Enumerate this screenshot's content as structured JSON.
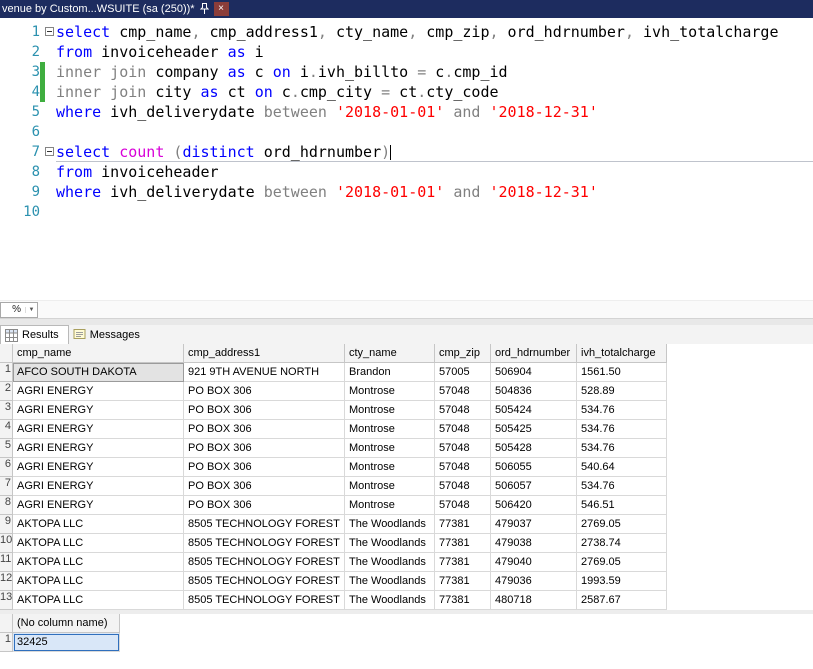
{
  "window": {
    "tab_title": "venue by Custom...WSUITE (sa (250))*",
    "close_glyph": "×"
  },
  "colors": {
    "keyword": "#0000ff",
    "operator": "#808080",
    "string": "#ff0000",
    "function": "#d800d8",
    "line_number": "#2b91af",
    "change_tracking": "#3fae3f",
    "tab_bar_background": "#1d2c5f",
    "selection_border": "#2f6fbd"
  },
  "editor": {
    "zoom_label": "%",
    "lines": [
      {
        "n": 1,
        "fold": true,
        "tokens": [
          {
            "t": "select",
            "c": "kw"
          },
          {
            "t": " cmp_name",
            "c": "pl"
          },
          {
            "t": ",",
            "c": "op"
          },
          {
            "t": " cmp_address1",
            "c": "pl"
          },
          {
            "t": ",",
            "c": "op"
          },
          {
            "t": " cty_name",
            "c": "pl"
          },
          {
            "t": ",",
            "c": "op"
          },
          {
            "t": " cmp_zip",
            "c": "pl"
          },
          {
            "t": ",",
            "c": "op"
          },
          {
            "t": " ord_hdrnumber",
            "c": "pl"
          },
          {
            "t": ",",
            "c": "op"
          },
          {
            "t": " ivh_totalcharge",
            "c": "pl"
          }
        ]
      },
      {
        "n": 2,
        "tokens": [
          {
            "t": "from",
            "c": "kw"
          },
          {
            "t": " invoiceheader ",
            "c": "pl"
          },
          {
            "t": "as",
            "c": "kw"
          },
          {
            "t": " i",
            "c": "pl"
          }
        ]
      },
      {
        "n": 3,
        "changed": true,
        "tokens": [
          {
            "t": "inner join",
            "c": "op"
          },
          {
            "t": " company ",
            "c": "pl"
          },
          {
            "t": "as",
            "c": "kw"
          },
          {
            "t": " c ",
            "c": "pl"
          },
          {
            "t": "on",
            "c": "kw"
          },
          {
            "t": " i",
            "c": "pl"
          },
          {
            "t": ".",
            "c": "op"
          },
          {
            "t": "ivh_billto ",
            "c": "pl"
          },
          {
            "t": "=",
            "c": "op"
          },
          {
            "t": " c",
            "c": "pl"
          },
          {
            "t": ".",
            "c": "op"
          },
          {
            "t": "cmp_id",
            "c": "pl"
          }
        ]
      },
      {
        "n": 4,
        "changed": true,
        "tokens": [
          {
            "t": "inner join",
            "c": "op"
          },
          {
            "t": " city ",
            "c": "pl"
          },
          {
            "t": "as",
            "c": "kw"
          },
          {
            "t": " ct ",
            "c": "pl"
          },
          {
            "t": "on",
            "c": "kw"
          },
          {
            "t": " c",
            "c": "pl"
          },
          {
            "t": ".",
            "c": "op"
          },
          {
            "t": "cmp_city ",
            "c": "pl"
          },
          {
            "t": "=",
            "c": "op"
          },
          {
            "t": " ct",
            "c": "pl"
          },
          {
            "t": ".",
            "c": "op"
          },
          {
            "t": "cty_code",
            "c": "pl"
          }
        ]
      },
      {
        "n": 5,
        "tokens": [
          {
            "t": "where",
            "c": "kw"
          },
          {
            "t": " ivh_deliverydate ",
            "c": "pl"
          },
          {
            "t": "between",
            "c": "op"
          },
          {
            "t": " ",
            "c": "pl"
          },
          {
            "t": "'2018-01-01'",
            "c": "str"
          },
          {
            "t": " ",
            "c": "pl"
          },
          {
            "t": "and",
            "c": "op"
          },
          {
            "t": " ",
            "c": "pl"
          },
          {
            "t": "'2018-12-31'",
            "c": "str"
          }
        ]
      },
      {
        "n": 6,
        "tokens": []
      },
      {
        "n": 7,
        "fold": true,
        "current": true,
        "caret": true,
        "tokens": [
          {
            "t": "select",
            "c": "kw"
          },
          {
            "t": " ",
            "c": "pl"
          },
          {
            "t": "count",
            "c": "fn"
          },
          {
            "t": " ",
            "c": "pl"
          },
          {
            "t": "(",
            "c": "op"
          },
          {
            "t": "distinct",
            "c": "kw"
          },
          {
            "t": " ord_hdrnumber",
            "c": "pl"
          },
          {
            "t": ")",
            "c": "op"
          }
        ]
      },
      {
        "n": 8,
        "tokens": [
          {
            "t": "from",
            "c": "kw"
          },
          {
            "t": " invoiceheader",
            "c": "pl"
          }
        ]
      },
      {
        "n": 9,
        "tokens": [
          {
            "t": "where",
            "c": "kw"
          },
          {
            "t": " ivh_deliverydate ",
            "c": "pl"
          },
          {
            "t": "between",
            "c": "op"
          },
          {
            "t": " ",
            "c": "pl"
          },
          {
            "t": "'2018-01-01'",
            "c": "str"
          },
          {
            "t": " ",
            "c": "pl"
          },
          {
            "t": "and",
            "c": "op"
          },
          {
            "t": " ",
            "c": "pl"
          },
          {
            "t": "'2018-12-31'",
            "c": "str"
          }
        ]
      },
      {
        "n": 10,
        "tokens": []
      }
    ]
  },
  "results": {
    "tabs": [
      {
        "label": "Results"
      },
      {
        "label": "Messages"
      }
    ],
    "grid": {
      "columns": [
        "cmp_name",
        "cmp_address1",
        "cty_name",
        "cmp_zip",
        "ord_hdrnumber",
        "ivh_totalcharge"
      ],
      "rows": [
        [
          "AFCO SOUTH DAKOTA",
          "921 9TH AVENUE NORTH",
          "Brandon",
          "57005",
          "506904",
          "1561.50"
        ],
        [
          "AGRI ENERGY",
          "PO BOX 306",
          "Montrose",
          "57048",
          "504836",
          "528.89"
        ],
        [
          "AGRI ENERGY",
          "PO BOX 306",
          "Montrose",
          "57048",
          "505424",
          "534.76"
        ],
        [
          "AGRI ENERGY",
          "PO BOX 306",
          "Montrose",
          "57048",
          "505425",
          "534.76"
        ],
        [
          "AGRI ENERGY",
          "PO BOX 306",
          "Montrose",
          "57048",
          "505428",
          "534.76"
        ],
        [
          "AGRI ENERGY",
          "PO BOX 306",
          "Montrose",
          "57048",
          "506055",
          "540.64"
        ],
        [
          "AGRI ENERGY",
          "PO BOX 306",
          "Montrose",
          "57048",
          "506057",
          "534.76"
        ],
        [
          "AGRI ENERGY",
          "PO BOX 306",
          "Montrose",
          "57048",
          "506420",
          "546.51"
        ],
        [
          "AKTOPA LLC",
          "8505 TECHNOLOGY FOREST",
          "The Woodlands",
          "77381",
          "479037",
          "2769.05"
        ],
        [
          "AKTOPA LLC",
          "8505 TECHNOLOGY FOREST",
          "The Woodlands",
          "77381",
          "479038",
          "2738.74"
        ],
        [
          "AKTOPA LLC",
          "8505 TECHNOLOGY FOREST",
          "The Woodlands",
          "77381",
          "479040",
          "2769.05"
        ],
        [
          "AKTOPA LLC",
          "8505 TECHNOLOGY FOREST",
          "The Woodlands",
          "77381",
          "479036",
          "1993.59"
        ],
        [
          "AKTOPA LLC",
          "8505 TECHNOLOGY FOREST",
          "The Woodlands",
          "77381",
          "480718",
          "2587.67"
        ]
      ],
      "selected_cell": {
        "row_index": 0,
        "column_index": 0,
        "style": "inactive"
      }
    },
    "scalar_grid": {
      "columns": [
        "(No column name)"
      ],
      "rows": [
        [
          "32425"
        ]
      ],
      "selected_cell": {
        "row_index": 0,
        "column_index": 0,
        "style": "active"
      }
    }
  }
}
